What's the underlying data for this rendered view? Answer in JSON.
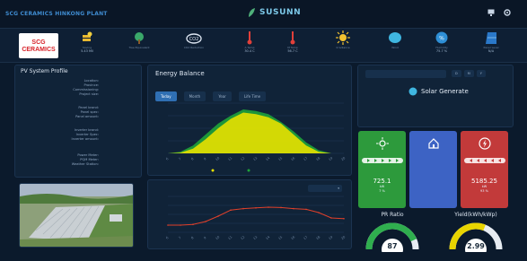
{
  "header": {
    "plant_name": "SCG CERAMICS HINKONG PLANT",
    "brand": "SUSUNN"
  },
  "top_icons": [
    "monitor-icon",
    "settings-icon"
  ],
  "logo": {
    "line1": "SCG",
    "line2": "CERAMICS"
  },
  "stats": [
    {
      "icon": "money-icon",
      "label": "Saving",
      "value": "5.43 Mil"
    },
    {
      "icon": "tree-icon",
      "label": "Tree Equivalent",
      "value": ""
    },
    {
      "icon": "co2-icon",
      "label": "CO2 Reduction",
      "value": ""
    },
    {
      "icon": "thermometer-icon",
      "label": "A Temp",
      "value": "30.4 C"
    },
    {
      "icon": "thermometer-icon",
      "label": "M Temp",
      "value": "56.7 C"
    },
    {
      "icon": "sun-icon",
      "label": "Irradiance",
      "value": ""
    },
    {
      "icon": "wind-icon",
      "label": "Wind",
      "value": ""
    },
    {
      "icon": "humidity-icon",
      "label": "Humidity",
      "value": "75.7 %"
    },
    {
      "icon": "panel-icon",
      "label": "Panel Level",
      "value": "N/A"
    }
  ],
  "profile": {
    "title": "PV System Profile",
    "rows": [
      {
        "k": "Location:",
        "v": ""
      },
      {
        "k": "Province:",
        "v": ""
      },
      {
        "k": "Commissioning:",
        "v": ""
      },
      {
        "k": "Project size:",
        "v": ""
      },
      {
        "k": "Panel brand:",
        "v": ""
      },
      {
        "k": "Panel spec:",
        "v": ""
      },
      {
        "k": "Panel amount:",
        "v": ""
      },
      {
        "k": "Inverter brand:",
        "v": ""
      },
      {
        "k": "Inverter Spec:",
        "v": ""
      },
      {
        "k": "Inverter amount:",
        "v": ""
      },
      {
        "k": "Power Meter:",
        "v": ""
      },
      {
        "k": "PQM Meter:",
        "v": ""
      },
      {
        "k": "Weather Station:",
        "v": ""
      }
    ]
  },
  "energy": {
    "title": "Energy Balance",
    "tabs": [
      "Today",
      "Month",
      "Year",
      "Life Time"
    ]
  },
  "chart_data": [
    {
      "type": "area",
      "title": "Energy Balance",
      "categories": [
        "6",
        "7",
        "8",
        "9",
        "10",
        "11",
        "12",
        "13",
        "14",
        "15",
        "16",
        "17",
        "18",
        "19",
        "20"
      ],
      "series": [
        {
          "name": "",
          "color": "#e8e000",
          "values": [
            0,
            2,
            15,
            45,
            80,
            110,
            130,
            125,
            115,
            95,
            60,
            25,
            5,
            0,
            0
          ]
        },
        {
          "name": "",
          "color": "#1fa33a",
          "values": [
            0,
            5,
            25,
            60,
            95,
            120,
            140,
            135,
            125,
            100,
            70,
            35,
            10,
            0,
            0
          ]
        }
      ],
      "ylim": [
        0,
        160
      ]
    },
    {
      "type": "line",
      "title": "",
      "categories": [
        "6",
        "7",
        "8",
        "9",
        "10",
        "11",
        "12",
        "13",
        "14",
        "15",
        "16",
        "17",
        "18",
        "19",
        "20"
      ],
      "series": [
        {
          "name": "",
          "color": "#e0402a",
          "values": [
            20,
            20,
            22,
            30,
            45,
            62,
            66,
            68,
            70,
            69,
            66,
            64,
            55,
            40,
            38
          ]
        }
      ],
      "ylim": [
        0,
        100
      ]
    }
  ],
  "line_select": "",
  "solar": {
    "title": "Solar Generate",
    "date_tabs": [
      "",
      "D",
      "M",
      "Y"
    ],
    "left_top": "",
    "left_val": "",
    "right_top": "",
    "right_val": ""
  },
  "cards": [
    {
      "color": "#2d9a3c",
      "icon": "sun-icon",
      "big": "725.1",
      "caption": "",
      "unit": "kW",
      "pct": "7 %"
    },
    {
      "color": "#3d63c4",
      "icon": "home-icon",
      "big": "",
      "caption": "",
      "unit": "",
      "pct": ""
    },
    {
      "color": "#c23a3a",
      "icon": "grid-power-icon",
      "big": "5185.25",
      "caption": "",
      "unit": "kW",
      "pct": "93 %"
    }
  ],
  "gauges": [
    {
      "title": "PR Ratio",
      "value": "87",
      "level": 0.87,
      "color": "#2fae4e"
    },
    {
      "title": "Yield(kWh/kWp)",
      "value": "2.99",
      "level": 0.62,
      "color": "#e8d400"
    }
  ]
}
